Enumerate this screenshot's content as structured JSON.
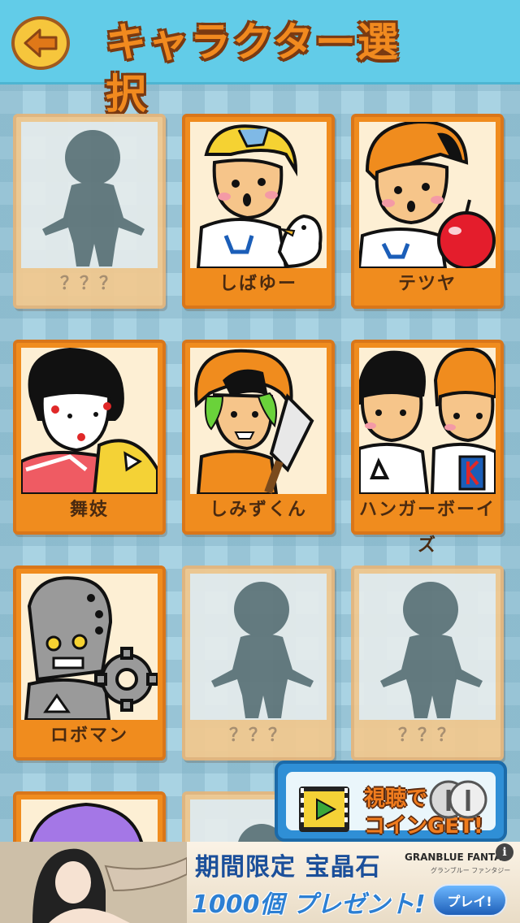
{
  "header": {
    "title": "キャラクター選択",
    "back_icon": "arrow-left-icon"
  },
  "characters": [
    {
      "name": "？？？",
      "locked": true
    },
    {
      "name": "しばゆー",
      "locked": false
    },
    {
      "name": "テツヤ",
      "locked": false
    },
    {
      "name": "舞妓",
      "locked": false
    },
    {
      "name": "しみずくん",
      "locked": false
    },
    {
      "name": "ハンガーボーイズ",
      "locked": false
    },
    {
      "name": "ロボマン",
      "locked": false
    },
    {
      "name": "？？？",
      "locked": true
    },
    {
      "name": "？？？",
      "locked": true
    }
  ],
  "video_reward": {
    "line1": "視聴で",
    "line2": "コインGET!",
    "icon": "play-video-icon"
  },
  "ad": {
    "line1_a": "期間限定",
    "line1_b": "宝晶石",
    "line2": "1000個 プレゼント!",
    "brand": "GRANBLUE FANTAS",
    "brand_sub": "グランブルー ファンタジー",
    "play_label": "プレイ!",
    "info": "i"
  },
  "colors": {
    "header_bg": "#62cce8",
    "card_orange": "#f08c1e",
    "title_orange": "#f18a1f",
    "video_blue": "#2f8fd6"
  }
}
